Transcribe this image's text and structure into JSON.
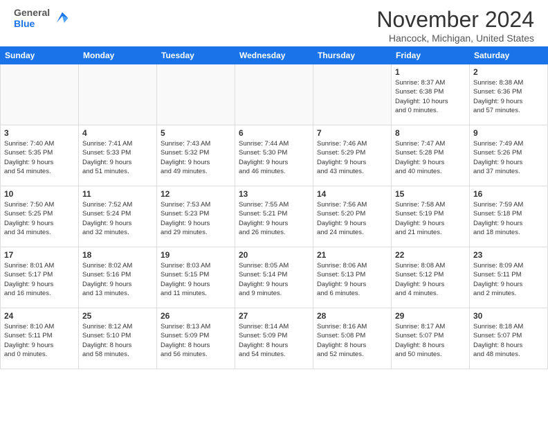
{
  "header": {
    "logo_general": "General",
    "logo_blue": "Blue",
    "month_title": "November 2024",
    "location": "Hancock, Michigan, United States"
  },
  "calendar": {
    "headers": [
      "Sunday",
      "Monday",
      "Tuesday",
      "Wednesday",
      "Thursday",
      "Friday",
      "Saturday"
    ],
    "weeks": [
      [
        {
          "day": "",
          "info": ""
        },
        {
          "day": "",
          "info": ""
        },
        {
          "day": "",
          "info": ""
        },
        {
          "day": "",
          "info": ""
        },
        {
          "day": "",
          "info": ""
        },
        {
          "day": "1",
          "info": "Sunrise: 8:37 AM\nSunset: 6:38 PM\nDaylight: 10 hours\nand 0 minutes."
        },
        {
          "day": "2",
          "info": "Sunrise: 8:38 AM\nSunset: 6:36 PM\nDaylight: 9 hours\nand 57 minutes."
        }
      ],
      [
        {
          "day": "3",
          "info": "Sunrise: 7:40 AM\nSunset: 5:35 PM\nDaylight: 9 hours\nand 54 minutes."
        },
        {
          "day": "4",
          "info": "Sunrise: 7:41 AM\nSunset: 5:33 PM\nDaylight: 9 hours\nand 51 minutes."
        },
        {
          "day": "5",
          "info": "Sunrise: 7:43 AM\nSunset: 5:32 PM\nDaylight: 9 hours\nand 49 minutes."
        },
        {
          "day": "6",
          "info": "Sunrise: 7:44 AM\nSunset: 5:30 PM\nDaylight: 9 hours\nand 46 minutes."
        },
        {
          "day": "7",
          "info": "Sunrise: 7:46 AM\nSunset: 5:29 PM\nDaylight: 9 hours\nand 43 minutes."
        },
        {
          "day": "8",
          "info": "Sunrise: 7:47 AM\nSunset: 5:28 PM\nDaylight: 9 hours\nand 40 minutes."
        },
        {
          "day": "9",
          "info": "Sunrise: 7:49 AM\nSunset: 5:26 PM\nDaylight: 9 hours\nand 37 minutes."
        }
      ],
      [
        {
          "day": "10",
          "info": "Sunrise: 7:50 AM\nSunset: 5:25 PM\nDaylight: 9 hours\nand 34 minutes."
        },
        {
          "day": "11",
          "info": "Sunrise: 7:52 AM\nSunset: 5:24 PM\nDaylight: 9 hours\nand 32 minutes."
        },
        {
          "day": "12",
          "info": "Sunrise: 7:53 AM\nSunset: 5:23 PM\nDaylight: 9 hours\nand 29 minutes."
        },
        {
          "day": "13",
          "info": "Sunrise: 7:55 AM\nSunset: 5:21 PM\nDaylight: 9 hours\nand 26 minutes."
        },
        {
          "day": "14",
          "info": "Sunrise: 7:56 AM\nSunset: 5:20 PM\nDaylight: 9 hours\nand 24 minutes."
        },
        {
          "day": "15",
          "info": "Sunrise: 7:58 AM\nSunset: 5:19 PM\nDaylight: 9 hours\nand 21 minutes."
        },
        {
          "day": "16",
          "info": "Sunrise: 7:59 AM\nSunset: 5:18 PM\nDaylight: 9 hours\nand 18 minutes."
        }
      ],
      [
        {
          "day": "17",
          "info": "Sunrise: 8:01 AM\nSunset: 5:17 PM\nDaylight: 9 hours\nand 16 minutes."
        },
        {
          "day": "18",
          "info": "Sunrise: 8:02 AM\nSunset: 5:16 PM\nDaylight: 9 hours\nand 13 minutes."
        },
        {
          "day": "19",
          "info": "Sunrise: 8:03 AM\nSunset: 5:15 PM\nDaylight: 9 hours\nand 11 minutes."
        },
        {
          "day": "20",
          "info": "Sunrise: 8:05 AM\nSunset: 5:14 PM\nDaylight: 9 hours\nand 9 minutes."
        },
        {
          "day": "21",
          "info": "Sunrise: 8:06 AM\nSunset: 5:13 PM\nDaylight: 9 hours\nand 6 minutes."
        },
        {
          "day": "22",
          "info": "Sunrise: 8:08 AM\nSunset: 5:12 PM\nDaylight: 9 hours\nand 4 minutes."
        },
        {
          "day": "23",
          "info": "Sunrise: 8:09 AM\nSunset: 5:11 PM\nDaylight: 9 hours\nand 2 minutes."
        }
      ],
      [
        {
          "day": "24",
          "info": "Sunrise: 8:10 AM\nSunset: 5:11 PM\nDaylight: 9 hours\nand 0 minutes."
        },
        {
          "day": "25",
          "info": "Sunrise: 8:12 AM\nSunset: 5:10 PM\nDaylight: 8 hours\nand 58 minutes."
        },
        {
          "day": "26",
          "info": "Sunrise: 8:13 AM\nSunset: 5:09 PM\nDaylight: 8 hours\nand 56 minutes."
        },
        {
          "day": "27",
          "info": "Sunrise: 8:14 AM\nSunset: 5:09 PM\nDaylight: 8 hours\nand 54 minutes."
        },
        {
          "day": "28",
          "info": "Sunrise: 8:16 AM\nSunset: 5:08 PM\nDaylight: 8 hours\nand 52 minutes."
        },
        {
          "day": "29",
          "info": "Sunrise: 8:17 AM\nSunset: 5:07 PM\nDaylight: 8 hours\nand 50 minutes."
        },
        {
          "day": "30",
          "info": "Sunrise: 8:18 AM\nSunset: 5:07 PM\nDaylight: 8 hours\nand 48 minutes."
        }
      ]
    ]
  }
}
